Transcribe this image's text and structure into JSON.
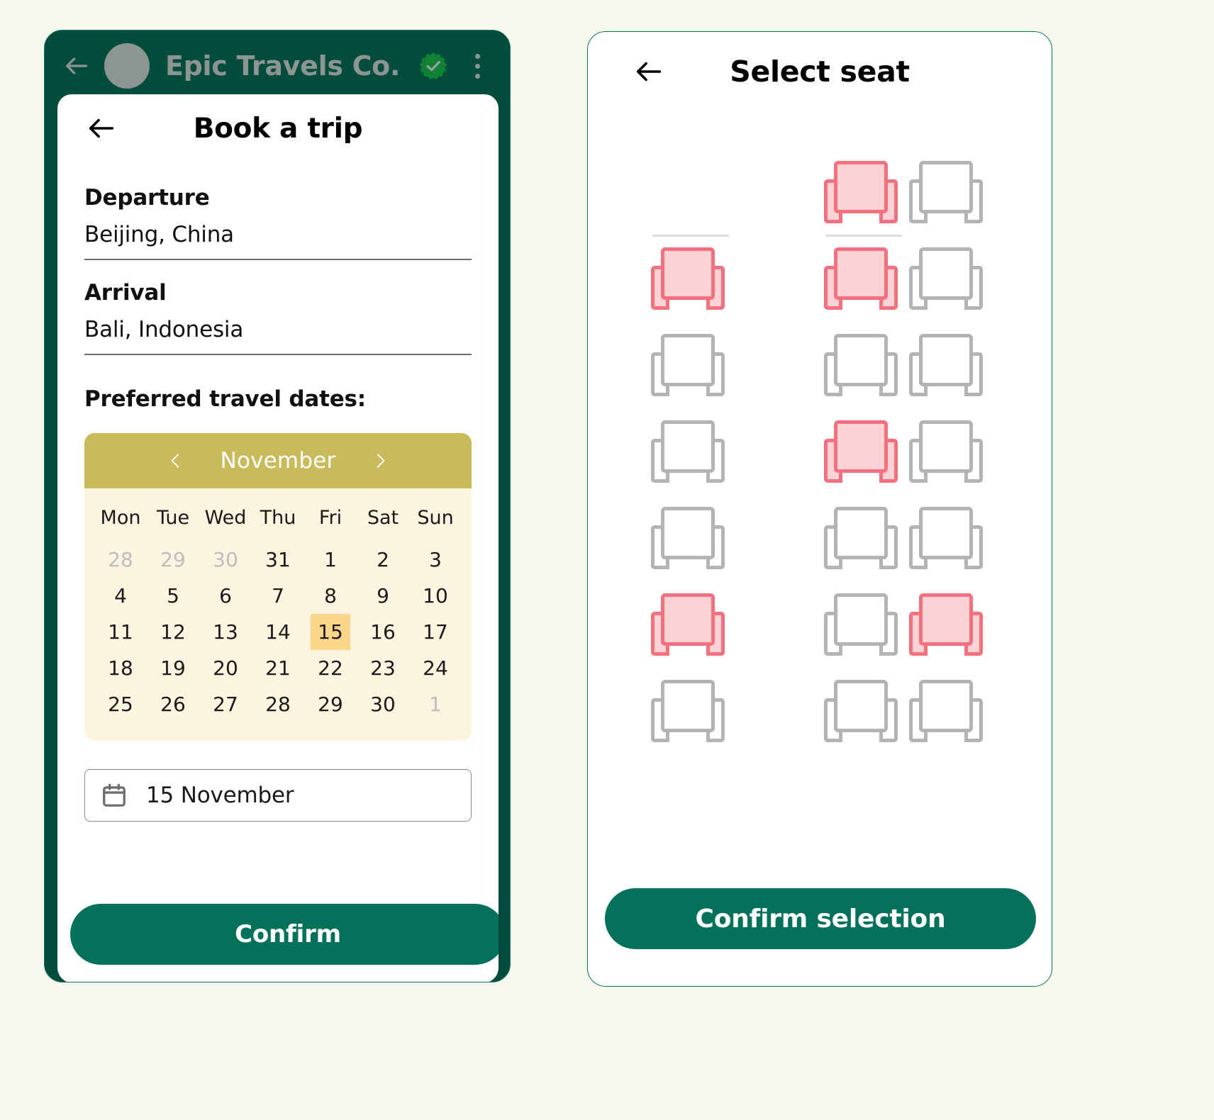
{
  "chat": {
    "contact_name": "Epic Travels Co.",
    "back_icon": "back-arrow-icon",
    "avatar_icon": "contact-avatar",
    "verified_icon": "verified-badge-icon",
    "menu_icon": "overflow-menu-icon",
    "header_bg": "#044c3c",
    "title_color": "#8d9593"
  },
  "book_trip": {
    "title": "Book a trip",
    "back_icon": "back-arrow-icon",
    "departure_label": "Departure",
    "departure_value": "Beijing, China",
    "arrival_label": "Arrival",
    "arrival_value": "Bali, Indonesia",
    "dates_label": "Preferred travel dates:",
    "confirm_label": "Confirm",
    "confirm_color": "#04715b"
  },
  "calendar": {
    "month": "November",
    "prev_icon": "chevron-left-icon",
    "next_icon": "chevron-right-icon",
    "header_bg": "#c9bb5c",
    "body_bg": "#fdf4e0",
    "selected_bg": "#fcd58a",
    "day_headers": [
      "Mon",
      "Tue",
      "Wed",
      "Thu",
      "Fri",
      "Sat",
      "Sun"
    ],
    "weeks": [
      [
        {
          "d": "28",
          "muted": true
        },
        {
          "d": "29",
          "muted": true
        },
        {
          "d": "30",
          "muted": true
        },
        {
          "d": "31",
          "muted": false
        },
        {
          "d": "1",
          "muted": false
        },
        {
          "d": "2",
          "muted": false
        },
        {
          "d": "3",
          "muted": false
        }
      ],
      [
        {
          "d": "4",
          "muted": false
        },
        {
          "d": "5",
          "muted": false
        },
        {
          "d": "6",
          "muted": false
        },
        {
          "d": "7",
          "muted": false
        },
        {
          "d": "8",
          "muted": false
        },
        {
          "d": "9",
          "muted": false
        },
        {
          "d": "10",
          "muted": false
        }
      ],
      [
        {
          "d": "11",
          "muted": false
        },
        {
          "d": "12",
          "muted": false
        },
        {
          "d": "13",
          "muted": false
        },
        {
          "d": "14",
          "muted": false
        },
        {
          "d": "15",
          "muted": false,
          "selected": true
        },
        {
          "d": "16",
          "muted": false
        },
        {
          "d": "17",
          "muted": false
        }
      ],
      [
        {
          "d": "18",
          "muted": false
        },
        {
          "d": "19",
          "muted": false
        },
        {
          "d": "20",
          "muted": false
        },
        {
          "d": "21",
          "muted": false
        },
        {
          "d": "22",
          "muted": false
        },
        {
          "d": "23",
          "muted": false
        },
        {
          "d": "24",
          "muted": false
        }
      ],
      [
        {
          "d": "25",
          "muted": false
        },
        {
          "d": "26",
          "muted": false
        },
        {
          "d": "27",
          "muted": false
        },
        {
          "d": "28",
          "muted": false
        },
        {
          "d": "29",
          "muted": false
        },
        {
          "d": "30",
          "muted": false
        },
        {
          "d": "1",
          "muted": true
        }
      ]
    ]
  },
  "date_field": {
    "icon": "calendar-icon",
    "value": "15 November"
  },
  "select_seat": {
    "title": "Select seat",
    "back_icon": "back-arrow-icon",
    "confirm_label": "Confirm selection",
    "confirm_color": "#04715b",
    "selected_color": "#f4707f",
    "available_color": "#b3b3b3",
    "columns": [
      {
        "name": "column-1",
        "seats": [
          {
            "row": 1,
            "state": "empty"
          },
          {
            "row": 2,
            "state": "selected",
            "divider": true
          },
          {
            "row": 3,
            "state": "available"
          },
          {
            "row": 4,
            "state": "available"
          },
          {
            "row": 5,
            "state": "available"
          },
          {
            "row": 6,
            "state": "selected"
          },
          {
            "row": 7,
            "state": "available"
          }
        ]
      },
      {
        "name": "column-2",
        "seats": [
          {
            "row": 1,
            "state": "selected"
          },
          {
            "row": 2,
            "state": "selected",
            "divider": true
          },
          {
            "row": 3,
            "state": "available"
          },
          {
            "row": 4,
            "state": "selected"
          },
          {
            "row": 5,
            "state": "available"
          },
          {
            "row": 6,
            "state": "available"
          },
          {
            "row": 7,
            "state": "available"
          }
        ]
      },
      {
        "name": "column-3",
        "seats": [
          {
            "row": 1,
            "state": "available"
          },
          {
            "row": 2,
            "state": "available"
          },
          {
            "row": 3,
            "state": "available"
          },
          {
            "row": 4,
            "state": "available"
          },
          {
            "row": 5,
            "state": "available"
          },
          {
            "row": 6,
            "state": "selected"
          },
          {
            "row": 7,
            "state": "available"
          }
        ]
      }
    ]
  }
}
